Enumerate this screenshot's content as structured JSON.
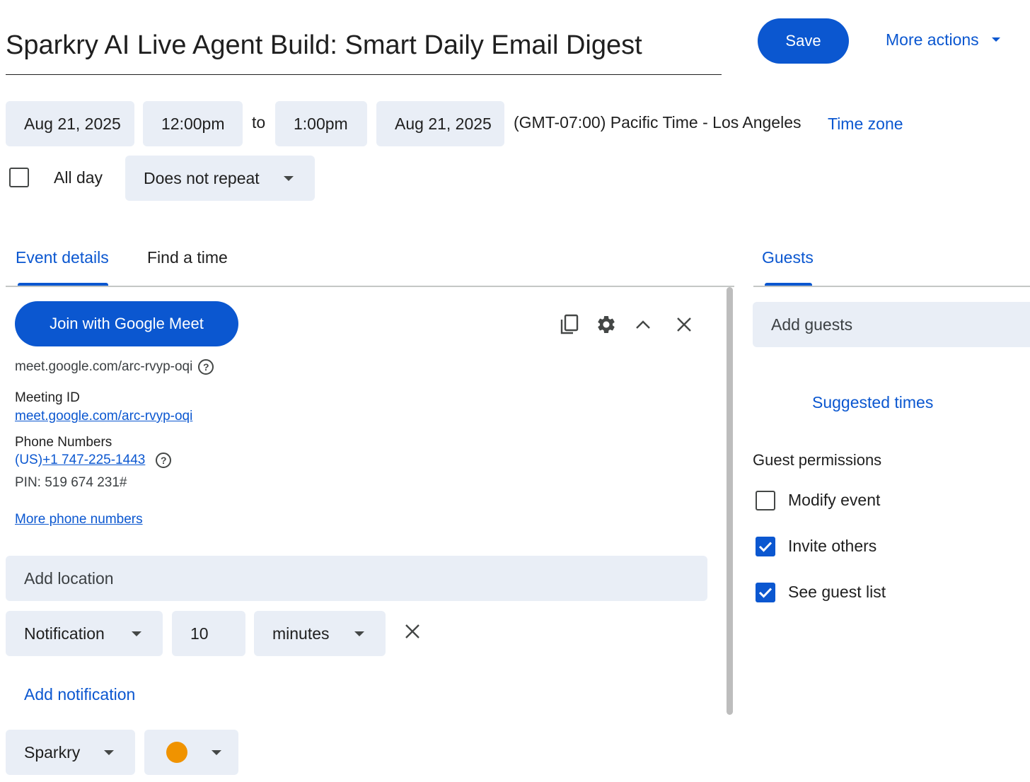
{
  "header": {
    "title": "Sparkry AI Live Agent Build: Smart Daily Email Digest",
    "save_label": "Save",
    "more_actions_label": "More actions"
  },
  "datetime": {
    "start_date": "Aug 21, 2025",
    "start_time": "12:00pm",
    "to_label": "to",
    "end_time": "1:00pm",
    "end_date": "Aug 21, 2025",
    "timezone_text": "(GMT-07:00) Pacific Time - Los Angeles",
    "timezone_link": "Time zone",
    "all_day_label": "All day",
    "all_day_checked": false,
    "repeat_value": "Does not repeat"
  },
  "tabs": [
    {
      "label": "Event details",
      "active": true
    },
    {
      "label": "Find a time",
      "active": false
    }
  ],
  "meet": {
    "join_label": "Join with Google Meet",
    "url_text": "meet.google.com/arc-rvyp-oqi",
    "meeting_id_heading": "Meeting ID",
    "meeting_id_link": "meet.google.com/arc-rvyp-oqi",
    "phone_heading": "Phone Numbers",
    "phone_prefix": "(US)",
    "phone_number": "+1 747-225-1443",
    "pin_text": "PIN: 519 674 231#",
    "more_phone_label": "More phone numbers",
    "icons": [
      "copy-icon",
      "gear-icon",
      "chevron-up-icon",
      "close-icon"
    ]
  },
  "location": {
    "placeholder": "Add location"
  },
  "notification": {
    "type": "Notification",
    "amount": "10",
    "unit": "minutes",
    "add_label": "Add notification"
  },
  "calendar": {
    "name": "Sparkry",
    "color": "#f09300"
  },
  "guests": {
    "tab_label": "Guests",
    "add_placeholder": "Add guests",
    "suggested_times_label": "Suggested times",
    "permissions_heading": "Guest permissions",
    "permissions": [
      {
        "label": "Modify event",
        "checked": false
      },
      {
        "label": "Invite others",
        "checked": true
      },
      {
        "label": "See guest list",
        "checked": true
      }
    ]
  },
  "colors": {
    "accent": "#0b57d0",
    "chip_bg": "#e9eef6",
    "text": "#1f1f1f"
  }
}
